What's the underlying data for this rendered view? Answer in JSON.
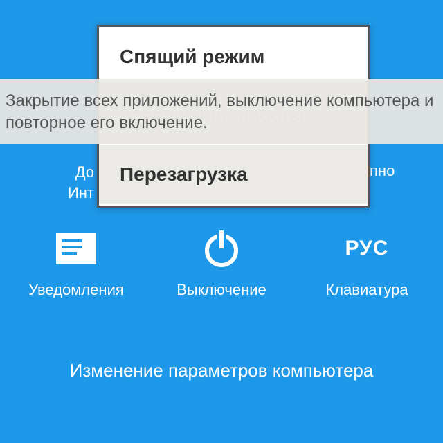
{
  "power_menu": {
    "items": [
      {
        "label": "Спящий режим",
        "selected": false,
        "faded": false
      },
      {
        "label": "Завершение работы",
        "selected": false,
        "faded": true
      },
      {
        "label": "Перезагрузка",
        "selected": true,
        "faded": false
      }
    ]
  },
  "tooltip": {
    "text": "Закрытие всех приложений, выключение компьютера и повторное его включение."
  },
  "background_truncated": {
    "left_line1": "До",
    "left_line2": "Инт",
    "right": "пно"
  },
  "charms": {
    "notifications": {
      "label": "Уведомления"
    },
    "power": {
      "label": "Выключение"
    },
    "keyboard": {
      "label": "Клавиатура",
      "badge": "РУС"
    }
  },
  "settings_link": "Изменение параметров компьютера"
}
